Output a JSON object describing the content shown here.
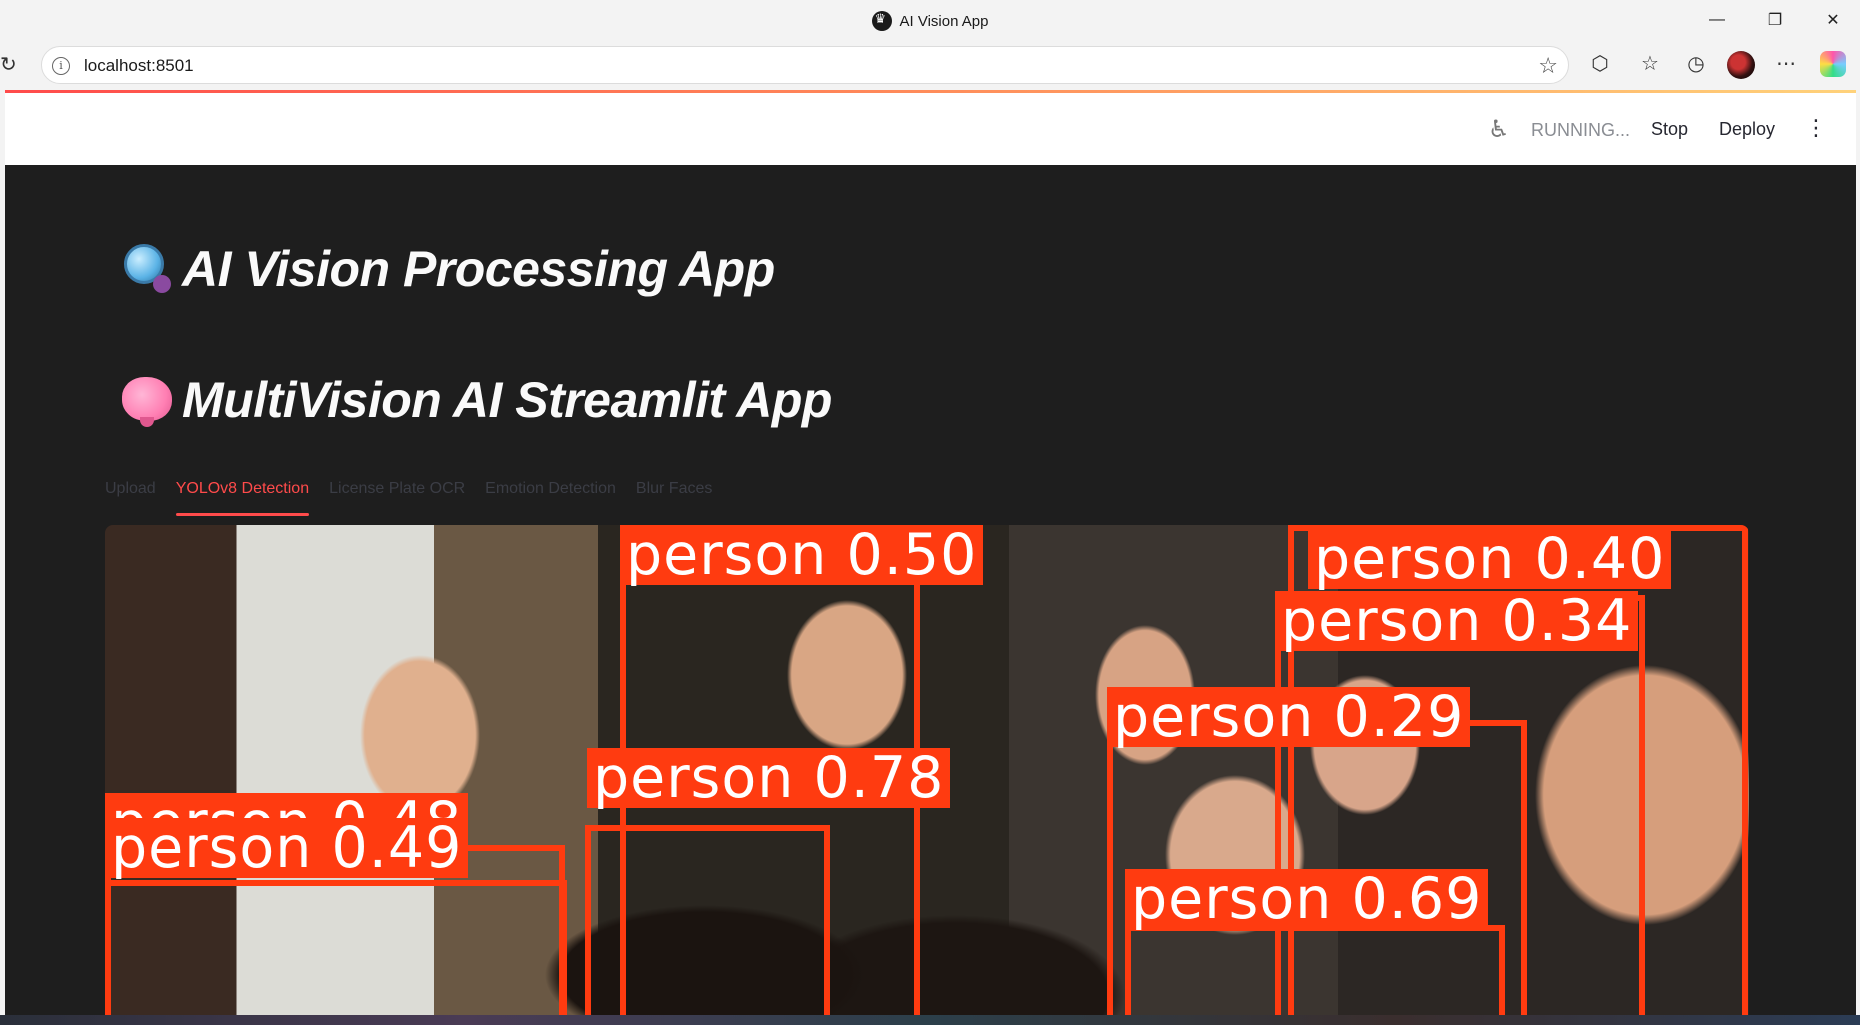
{
  "window": {
    "title": "AI Vision App",
    "controls": {
      "minimize": "—",
      "restore": "❐",
      "close": "✕"
    }
  },
  "browser": {
    "url": "localhost:8501",
    "icons": [
      "reload-icon",
      "site-info-icon",
      "favorite-star-icon",
      "extensions-icon",
      "favorites-icon",
      "history-icon",
      "profile-avatar",
      "more-icon",
      "copilot-icon"
    ]
  },
  "streamlit_header": {
    "status": "RUNNING...",
    "stop_label": "Stop",
    "deploy_label": "Deploy",
    "menu_glyph": "⋮"
  },
  "main": {
    "title1": "AI Vision Processing App",
    "title2": "MultiVision AI Streamlit App",
    "tabs": [
      {
        "label": "Upload",
        "active": false
      },
      {
        "label": "YOLOv8 Detection",
        "active": true
      },
      {
        "label": "License Plate OCR",
        "active": false
      },
      {
        "label": "Emotion Detection",
        "active": false
      },
      {
        "label": "Blur Faces",
        "active": false
      }
    ],
    "accent": "#ff4b4b",
    "detections": [
      {
        "label": "person 0.50"
      },
      {
        "label": "person 0.40"
      },
      {
        "label": "person 0.34"
      },
      {
        "label": "person 0.29"
      },
      {
        "label": "person 0.78"
      },
      {
        "label": "person 0.48"
      },
      {
        "label": "person 0.49"
      },
      {
        "label": "person 0.69"
      }
    ],
    "box_color": "#ff3b10"
  }
}
